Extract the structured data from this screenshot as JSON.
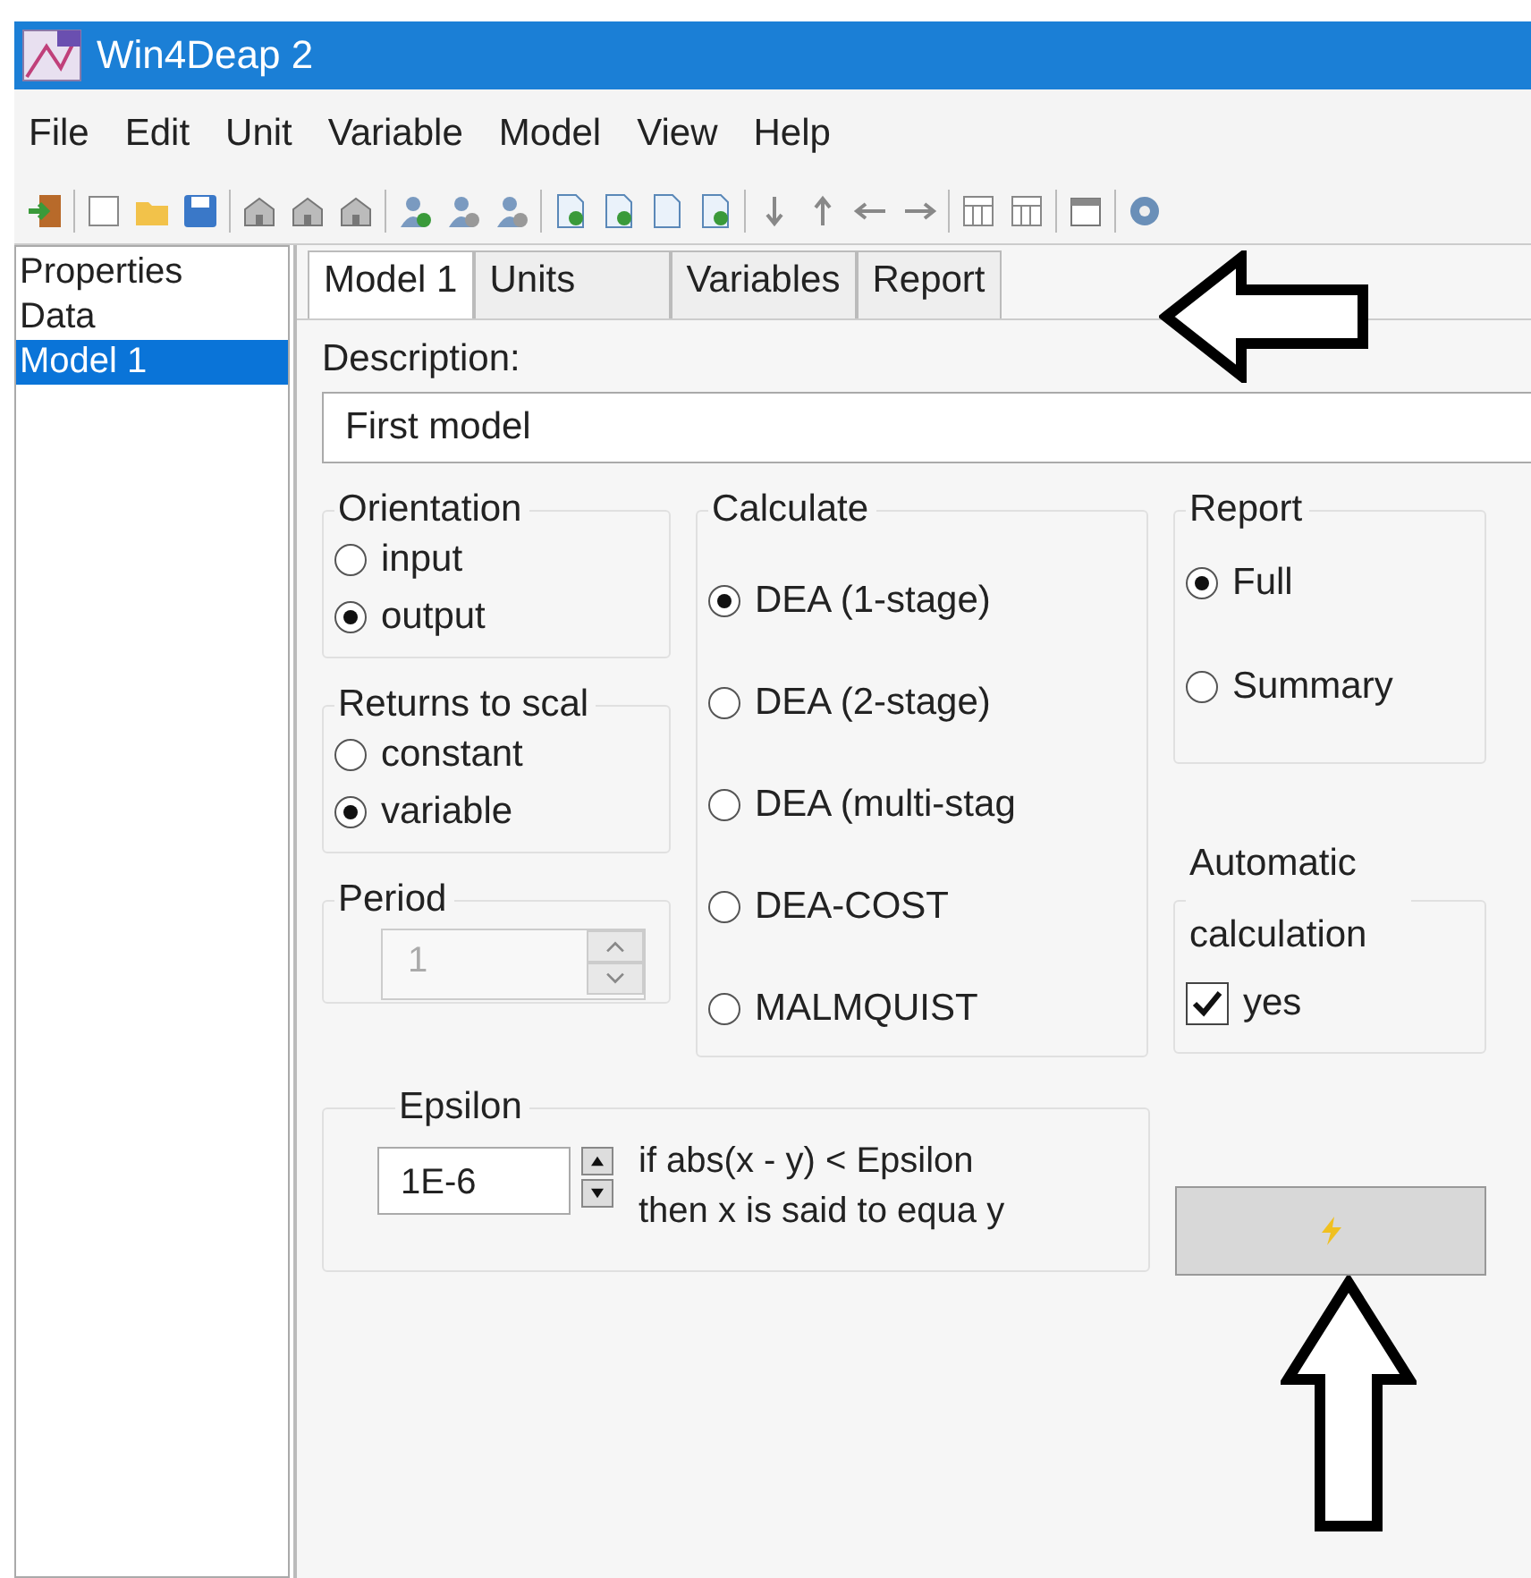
{
  "window": {
    "title": "Win4Deap 2"
  },
  "menu": [
    "File",
    "Edit",
    "Unit",
    "Variable",
    "Model",
    "View",
    "Help"
  ],
  "sidebar": {
    "items": [
      {
        "label": "Properties",
        "selected": false
      },
      {
        "label": "Data",
        "selected": false
      },
      {
        "label": "Model 1",
        "selected": true
      }
    ]
  },
  "tabs": [
    {
      "label": "Model 1",
      "selected": true
    },
    {
      "label": "Units",
      "selected": false
    },
    {
      "label": "Variables",
      "selected": false
    },
    {
      "label": "Report",
      "selected": false
    }
  ],
  "description": {
    "label": "Description:",
    "value": "First model"
  },
  "orientation": {
    "title": "Orientation",
    "options": [
      {
        "label": "input",
        "selected": false
      },
      {
        "label": "output",
        "selected": true
      }
    ]
  },
  "returns_to_scale": {
    "title": "Returns to scal",
    "options": [
      {
        "label": "constant",
        "selected": false
      },
      {
        "label": "variable",
        "selected": true
      }
    ]
  },
  "period": {
    "title": "Period",
    "value": "1",
    "disabled": true
  },
  "calculate": {
    "title": "Calculate",
    "options": [
      {
        "label": "DEA (1-stage)",
        "selected": true
      },
      {
        "label": "DEA (2-stage)",
        "selected": false
      },
      {
        "label": "DEA (multi-stag",
        "selected": false
      },
      {
        "label": "DEA-COST",
        "selected": false
      },
      {
        "label": "MALMQUIST",
        "selected": false
      }
    ]
  },
  "report": {
    "title": "Report",
    "options": [
      {
        "label": "Full",
        "selected": true
      },
      {
        "label": "Summary",
        "selected": false
      }
    ]
  },
  "automatic_calculation": {
    "title": "Automatic calculation",
    "checkbox": {
      "label": "yes",
      "checked": true
    }
  },
  "epsilon": {
    "title": "Epsilon",
    "value": "1E-6",
    "lines": [
      "if abs(x - y) < Epsilon",
      "then x is said to equa y"
    ]
  }
}
